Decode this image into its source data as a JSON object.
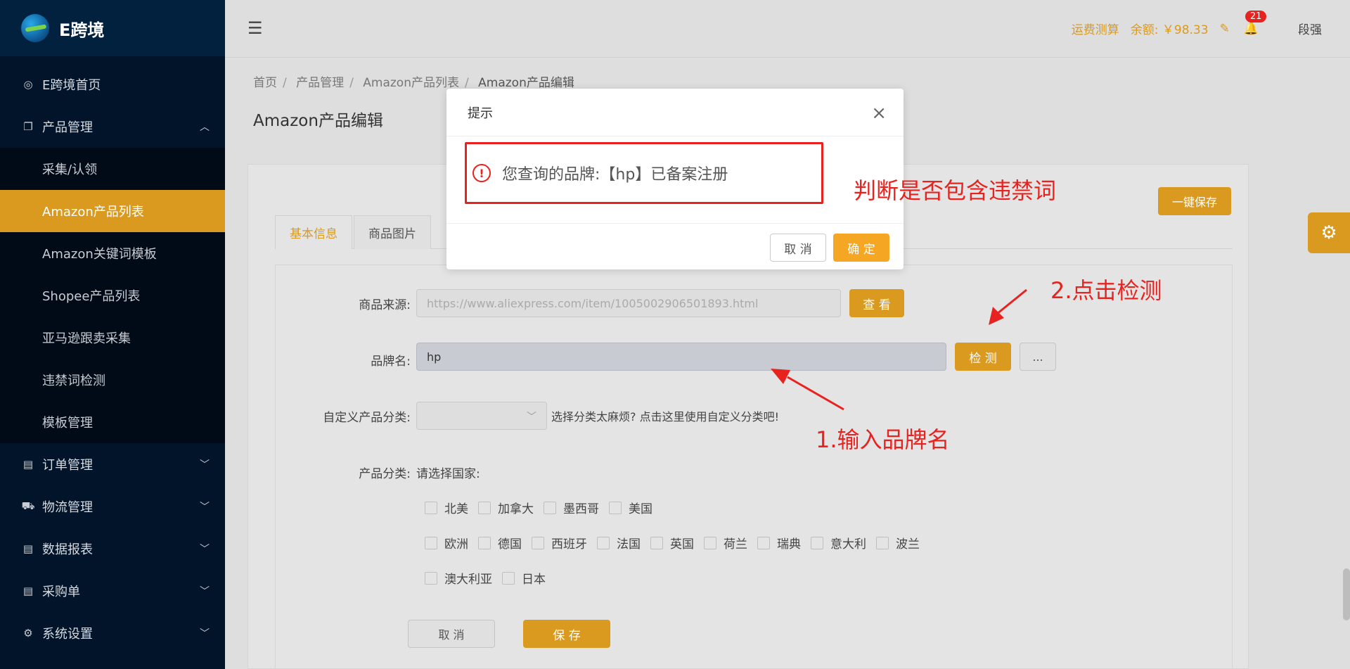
{
  "app": {
    "name": "E跨境"
  },
  "sidebar": {
    "items": [
      {
        "label": "E跨境首页",
        "icon": "eye-icon"
      },
      {
        "label": "产品管理",
        "icon": "copy-icon",
        "expanded": true,
        "children": [
          {
            "label": "采集/认领"
          },
          {
            "label": "Amazon产品列表",
            "active": true
          },
          {
            "label": "Amazon关键词模板"
          },
          {
            "label": "Shopee产品列表"
          },
          {
            "label": "亚马逊跟卖采集"
          },
          {
            "label": "违禁词检测"
          },
          {
            "label": "模板管理"
          }
        ]
      },
      {
        "label": "订单管理",
        "icon": "list-icon"
      },
      {
        "label": "物流管理",
        "icon": "truck-icon"
      },
      {
        "label": "数据报表",
        "icon": "list-icon"
      },
      {
        "label": "采购单",
        "icon": "list-icon"
      },
      {
        "label": "系统设置",
        "icon": "gear-icon"
      }
    ]
  },
  "header": {
    "freight": "运费测算",
    "balance": "余额: ￥98.33",
    "notifications": "21",
    "user": "段强"
  },
  "breadcrumb": [
    "首页",
    "产品管理",
    "Amazon产品列表",
    "Amazon产品编辑"
  ],
  "page": {
    "title": "Amazon产品编辑",
    "save_all": "一键保存",
    "tabs": [
      "基本信息",
      "商品图片"
    ]
  },
  "form": {
    "source_label": "商品来源:",
    "source_value": "https://www.aliexpress.com/item/1005002906501893.html",
    "view_button": "查 看",
    "brand_label": "品牌名:",
    "brand_value": "hp",
    "detect_button": "检 测",
    "more_button": "...",
    "custom_category_label": "自定义产品分类:",
    "custom_category_hint": "选择分类太麻烦? 点击这里使用自定义分类吧!",
    "category_label": "产品分类:",
    "country_prompt": "请选择国家:",
    "countries_row1": [
      "北美",
      "加拿大",
      "墨西哥",
      "美国"
    ],
    "countries_row2": [
      "欧洲",
      "德国",
      "西班牙",
      "法国",
      "英国",
      "荷兰",
      "瑞典",
      "意大利",
      "波兰"
    ],
    "countries_row3": [
      "澳大利亚",
      "日本"
    ],
    "cancel_button": "取 消",
    "save_button": "保 存"
  },
  "dialog": {
    "title": "提示",
    "message": "您查询的品牌:【hp】已备案注册",
    "cancel": "取 消",
    "ok": "确 定"
  },
  "annotations": {
    "step1": "1.输入品牌名",
    "step2": "2.点击检测",
    "note": "判断是否包含违禁词"
  },
  "colors": {
    "accent": "#d99a1f",
    "sidebar": "#01142a",
    "annotation": "#e8231f"
  }
}
